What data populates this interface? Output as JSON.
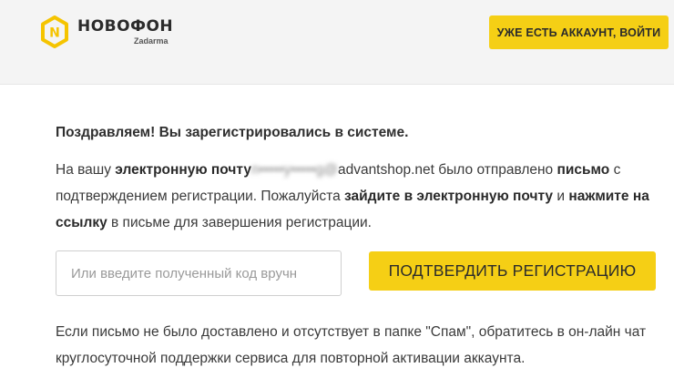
{
  "header": {
    "logo_name": "НОВОФОН",
    "logo_sub": "Zadarma",
    "login_button": "УЖЕ ЕСТЬ АККАУНТ, ВОЙТИ"
  },
  "main": {
    "title": "Поздравляем! Вы зарегистрировались в системе.",
    "message": {
      "p1": "На вашу ",
      "b1": "электронную почту",
      "email_hidden": " n•••••y•••••g@",
      "email_domain": "advantshop.net",
      "p2": " было отправлено ",
      "b2": "письмо",
      "p3": " с подтверждением регистрации. Пожалуйста ",
      "b3": "зайдите в электронную почту",
      "p4": " и ",
      "b4": "нажмите на ссылку",
      "p5": " в письме для завершения регистрации."
    },
    "code_input_placeholder": "Или введите полученный код вручн",
    "confirm_button": "ПОДТВЕРДИТЬ РЕГИСТРАЦИЮ",
    "note": "Если письмо не было доставлено и отсутствует в папке \"Спам\", обратитесь в он-лайн чат круглосуточной поддержки сервиса для повторной активации аккаунта."
  },
  "colors": {
    "accent": "#f5cf15",
    "header_bg": "#f4f4f4"
  }
}
